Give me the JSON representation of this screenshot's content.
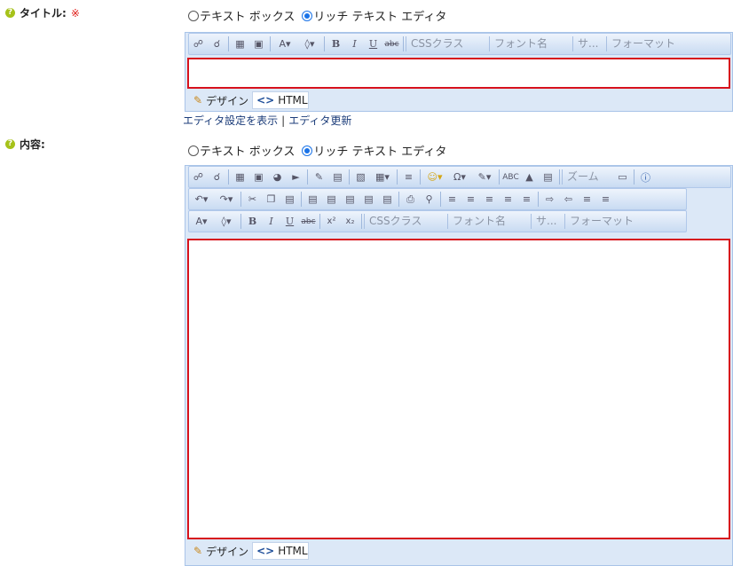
{
  "title_field": {
    "label": "タイトル:",
    "required_mark": "※",
    "mode_text_box": "テキスト ボックス",
    "mode_rich_editor": "リッチ テキスト エディタ",
    "toolbar": {
      "css_class": "CSSクラス",
      "font_name": "フォント名",
      "size": "サ...",
      "format": "フォーマット"
    },
    "bottom_tabs": {
      "design": "デザイン",
      "html": "HTML"
    }
  },
  "editor_links": {
    "show_settings": "エディタ設定を表示",
    "separator": "|",
    "update": "エディタ更新"
  },
  "content_field": {
    "label": "内容:",
    "mode_text_box": "テキスト ボックス",
    "mode_rich_editor": "リッチ テキスト エディタ",
    "toolbar": {
      "zoom": "ズーム",
      "css_class": "CSSクラス",
      "font_name": "フォント名",
      "size": "サ...",
      "format": "フォーマット"
    },
    "bottom_tabs": {
      "design": "デザイン",
      "html": "HTML"
    }
  },
  "colors": {
    "accent_red": "#d7121d",
    "toolbar_bg": "#dce8f7",
    "help_icon": "#a6c21a",
    "link_blue": "#1c3d7a"
  }
}
